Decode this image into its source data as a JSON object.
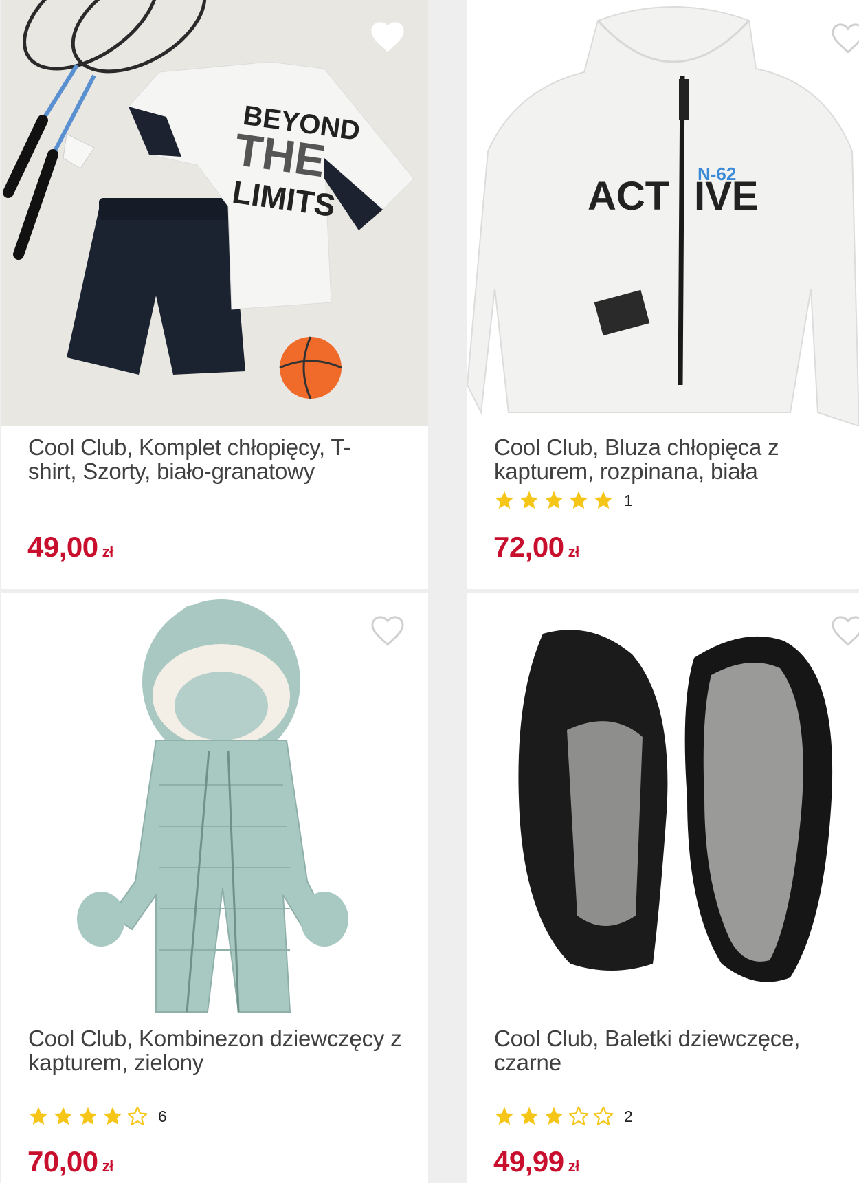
{
  "colors": {
    "price": "#c8102e",
    "star": "#f5c518",
    "background": "#eeeeee"
  },
  "products": [
    {
      "title": "Cool Club, Komplet chłopięcy, T-shirt, Szorty, biało-granatowy",
      "price": "49,00",
      "currency": "zł",
      "favorite": true,
      "favorite_icon": "heart-filled-icon"
    },
    {
      "title": "Cool Club, Bluza chłopięca z kapturem, rozpinana, biała",
      "price": "72,00",
      "currency": "zł",
      "rating": 5,
      "rating_count": "1",
      "favorite": false,
      "favorite_icon": "heart-outline-icon",
      "print_text": [
        "ACT",
        "IVE",
        "N-62"
      ]
    },
    {
      "title": "Cool Club, Kombinezon dziewczęcy z kapturem, zielony",
      "price": "70,00",
      "currency": "zł",
      "rating": 4,
      "rating_count": "6",
      "favorite": false,
      "favorite_icon": "heart-outline-icon"
    },
    {
      "title": "Cool Club, Baletki dziewczęce, czarne",
      "price": "49,99",
      "currency": "zł",
      "rating": 3,
      "rating_count": "2",
      "favorite": false,
      "favorite_icon": "heart-outline-icon"
    }
  ],
  "tshirt_print": [
    "BEYOND",
    "THE",
    "LIMITS"
  ]
}
